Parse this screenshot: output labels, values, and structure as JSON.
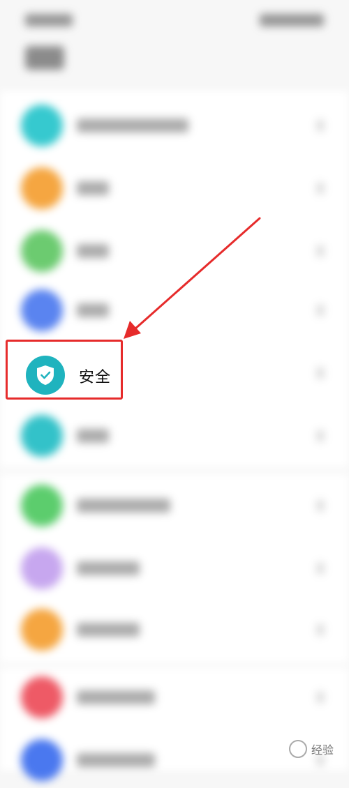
{
  "app": {
    "title": "设置"
  },
  "highlight": {
    "label": "安全",
    "icon": "shield-check-icon",
    "icon_color": "#1fb3be",
    "border_color": "#e62b2b"
  },
  "blurred_rows": [
    {
      "icon": "bluetooth-icon",
      "color": "#36c9cf"
    },
    {
      "icon": "display-icon",
      "color": "#f5a641"
    },
    {
      "icon": "sound-icon",
      "color": "#6ccb70"
    },
    {
      "icon": "notification-icon",
      "color": "#5a84f0"
    },
    {
      "icon": "privacy-icon",
      "color": "#33c2c9"
    },
    {
      "icon": "battery-icon",
      "color": "#5ccd6d"
    },
    {
      "icon": "wallpaper-icon",
      "color": "#c7a7ef"
    },
    {
      "icon": "apps-icon",
      "color": "#f5a641"
    },
    {
      "icon": "account-icon",
      "color": "#ee5a66"
    },
    {
      "icon": "system-icon",
      "color": "#4a78ef"
    }
  ],
  "watermark": {
    "text": "经验"
  }
}
